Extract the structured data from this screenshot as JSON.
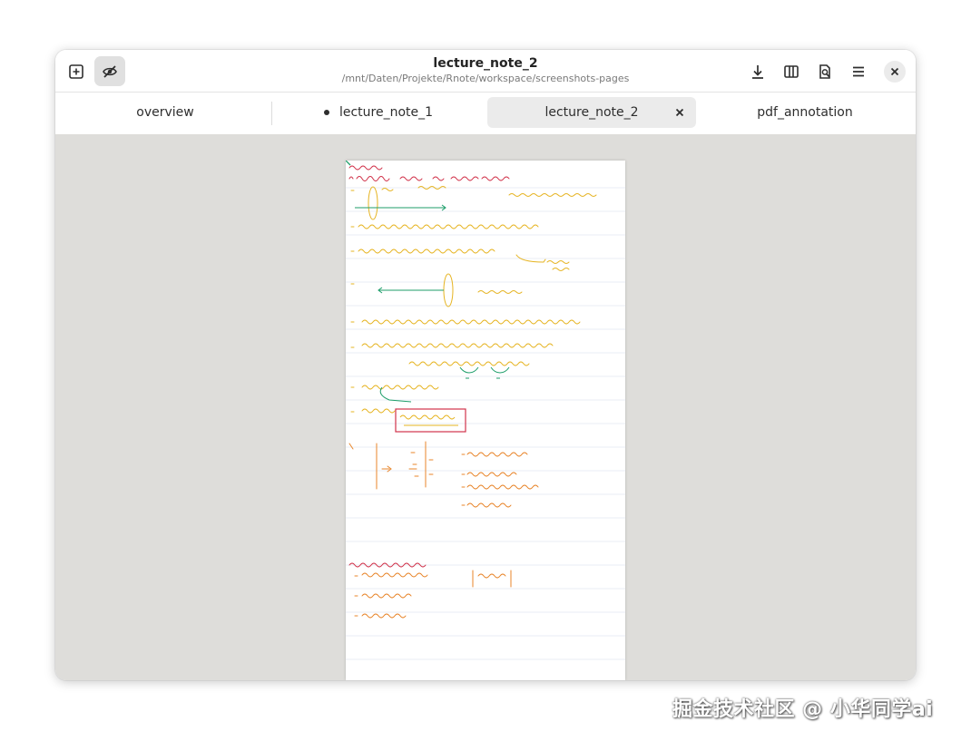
{
  "window": {
    "title": "lecture_note_2",
    "subtitle": "/mnt/Daten/Projekte/Rnote/workspace/screenshots-pages"
  },
  "headerbar": {
    "left_buttons": [
      {
        "icon": "new-tab-icon"
      },
      {
        "icon": "eye-off-icon",
        "toggled": true
      }
    ],
    "right_buttons": [
      {
        "icon": "download-icon"
      },
      {
        "icon": "columns-icon"
      },
      {
        "icon": "document-zoom-icon"
      },
      {
        "icon": "menu-icon"
      },
      {
        "icon": "close-icon"
      }
    ]
  },
  "tabs": [
    {
      "label": "overview",
      "active": false,
      "modified": false
    },
    {
      "label": "lecture_note_1",
      "active": false,
      "modified": true
    },
    {
      "label": "lecture_note_2",
      "active": true,
      "modified": false
    },
    {
      "label": "pdf_annotation",
      "active": false,
      "modified": false
    }
  ],
  "colors": {
    "canvas_bg": "#deddda",
    "ink_red": "#d1334b",
    "ink_yellow": "#e6b422",
    "ink_green": "#1e9e6a",
    "ink_orange": "#e8852a"
  },
  "watermark": "掘金技术社区 @ 小华同学ai"
}
